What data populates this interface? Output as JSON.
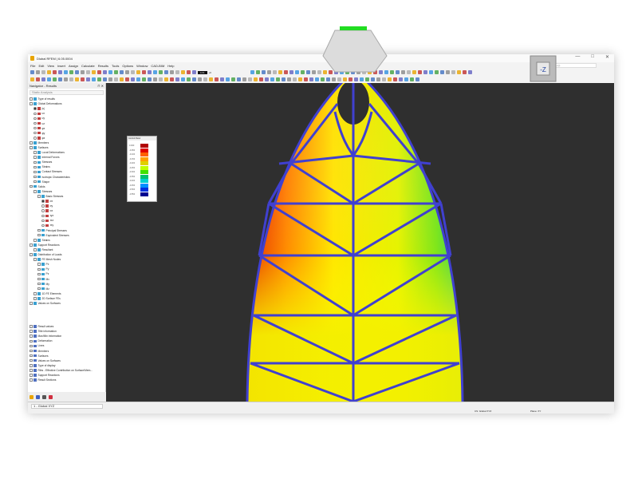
{
  "window": {
    "title": "Dlubal RFEM | 6.05.0004",
    "minimize": "—",
    "maximize": "□",
    "close": "✕"
  },
  "menu": [
    "File",
    "Edit",
    "View",
    "Insert",
    "Assign",
    "Calculate",
    "Results",
    "Tools",
    "Options",
    "Window",
    "CAD-BIM",
    "Help"
  ],
  "toolbar": {
    "load_case_id": "LC1",
    "load_case_value": "+0",
    "search_placeholder": "Type a keyword (Alt+Q)"
  },
  "navigator": {
    "title": "Navigator - Results",
    "analysis": "Static Analysis",
    "items": [
      {
        "l": "Type of results",
        "d": 0,
        "k": "cb"
      },
      {
        "l": "Global Deformations",
        "d": 0,
        "k": "cb"
      },
      {
        "l": "|u|",
        "d": 1,
        "k": "rad",
        "on": true
      },
      {
        "l": "ux",
        "d": 1,
        "k": "rad"
      },
      {
        "l": "uy",
        "d": 1,
        "k": "rad"
      },
      {
        "l": "uz",
        "d": 1,
        "k": "rad"
      },
      {
        "l": "φx",
        "d": 1,
        "k": "rad"
      },
      {
        "l": "φy",
        "d": 1,
        "k": "rad"
      },
      {
        "l": "φz",
        "d": 1,
        "k": "rad"
      },
      {
        "l": "Members",
        "d": 0,
        "k": "cb"
      },
      {
        "l": "Surfaces",
        "d": 0,
        "k": "cb"
      },
      {
        "l": "Local Deformations",
        "d": 1,
        "k": "cb"
      },
      {
        "l": "Internal Forces",
        "d": 1,
        "k": "cb"
      },
      {
        "l": "Stresses",
        "d": 1,
        "k": "cb"
      },
      {
        "l": "Strains",
        "d": 1,
        "k": "cb"
      },
      {
        "l": "Contact Stresses",
        "d": 1,
        "k": "cb"
      },
      {
        "l": "Isotropic Characteristics",
        "d": 1,
        "k": "cb"
      },
      {
        "l": "Shape",
        "d": 1,
        "k": "cb"
      },
      {
        "l": "Solids",
        "d": 0,
        "k": "cb"
      },
      {
        "l": "Stresses",
        "d": 1,
        "k": "cb"
      },
      {
        "l": "Basic Stresses",
        "d": 2,
        "k": "cb"
      },
      {
        "l": "σx",
        "d": 3,
        "k": "rad",
        "on": true
      },
      {
        "l": "σy",
        "d": 3,
        "k": "rad"
      },
      {
        "l": "σz",
        "d": 3,
        "k": "rad"
      },
      {
        "l": "τyz",
        "d": 3,
        "k": "rad"
      },
      {
        "l": "τxz",
        "d": 3,
        "k": "rad"
      },
      {
        "l": "τxy",
        "d": 3,
        "k": "rad"
      },
      {
        "l": "Principal Stresses",
        "d": 2,
        "k": "cb"
      },
      {
        "l": "Equivalent Stresses",
        "d": 2,
        "k": "cb"
      },
      {
        "l": "Strains",
        "d": 1,
        "k": "cb"
      },
      {
        "l": "Support Reactions",
        "d": 0,
        "k": "cb"
      },
      {
        "l": "Resultant",
        "d": 1,
        "k": "cb"
      },
      {
        "l": "Distribution of Loads",
        "d": 0,
        "k": "cb"
      },
      {
        "l": "FE Mesh Nodes",
        "d": 1,
        "k": "cb"
      },
      {
        "l": "Px",
        "d": 2,
        "k": "cb"
      },
      {
        "l": "Py",
        "d": 2,
        "k": "cb"
      },
      {
        "l": "Pz",
        "d": 2,
        "k": "cb"
      },
      {
        "l": "Mx",
        "d": 2,
        "k": "cb"
      },
      {
        "l": "My",
        "d": 2,
        "k": "cb"
      },
      {
        "l": "Mz",
        "d": 2,
        "k": "cb"
      },
      {
        "l": "1D FE Elements",
        "d": 1,
        "k": "cb"
      },
      {
        "l": "2D Surface FEs",
        "d": 1,
        "k": "cb"
      },
      {
        "l": "Values on Surfaces",
        "d": 0,
        "k": "cb"
      }
    ],
    "items2": [
      "Result values",
      "Title information",
      "Max/Min information",
      "Deformation",
      "Lines",
      "Members",
      "Surfaces",
      "Values on Surfaces",
      "Type of display",
      "Ribs - Effective Contribution on Surface/Mem...",
      "Support Reactions",
      "Result Sections"
    ]
  },
  "legend": {
    "title": "Control Panel",
    "values": [
      "0.000",
      "-0.050",
      "-0.100",
      "-0.150",
      "-0.200",
      "-0.250",
      "-0.300",
      "-0.350",
      "-0.400",
      "-0.450",
      "-0.500",
      "-0.550"
    ],
    "colors": [
      "#b00000",
      "#e00000",
      "#ff6000",
      "#ffa000",
      "#e0d000",
      "#c0ff00",
      "#40e000",
      "#00c070",
      "#00d0d0",
      "#0090ff",
      "#0030e0",
      "#000090"
    ]
  },
  "status": {
    "coord_system": "1 - Global XYZ",
    "cs": "CS: Global XYZ",
    "plane": "Plane: XY"
  },
  "cube_label": "-Z"
}
